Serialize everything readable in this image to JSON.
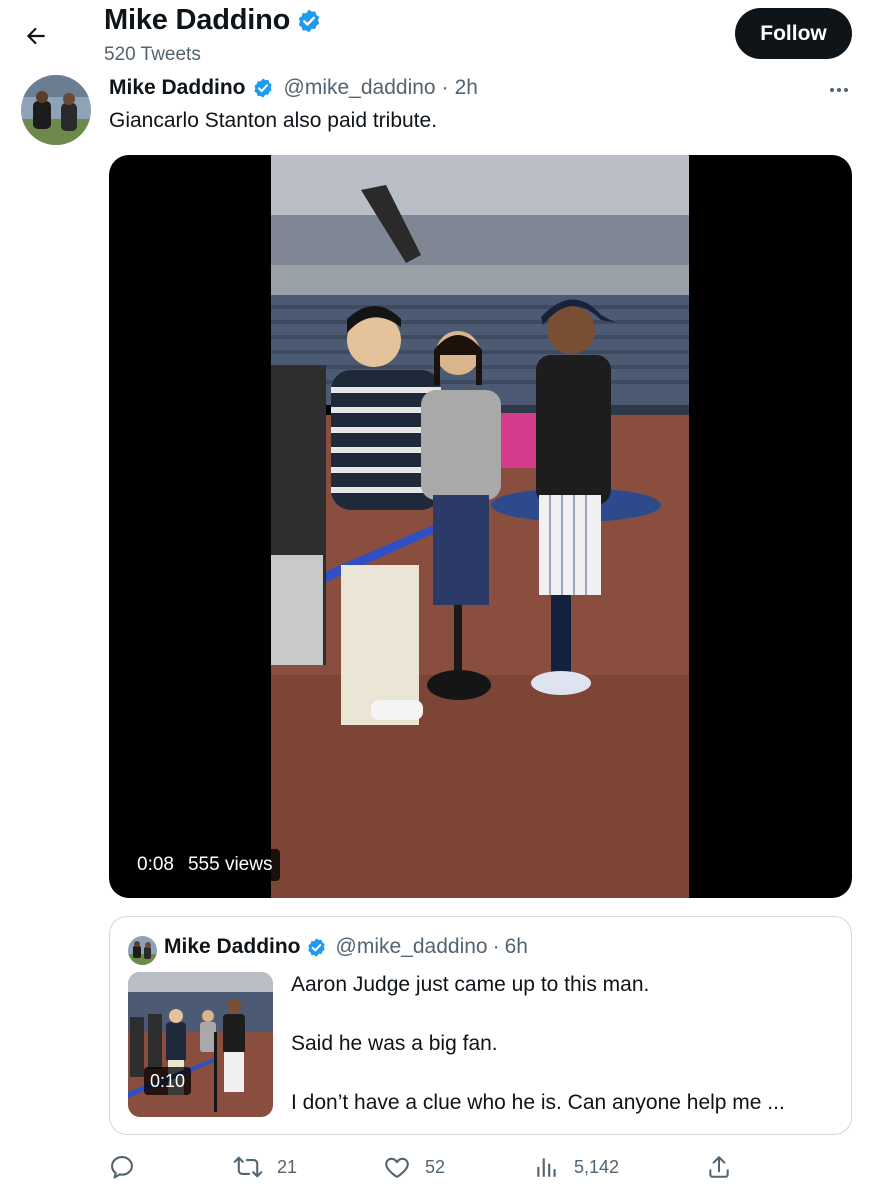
{
  "header": {
    "name": "Mike Daddino",
    "tweets_count": "520 Tweets",
    "follow_label": "Follow"
  },
  "tweet": {
    "name": "Mike Daddino",
    "handle": "@mike_daddino",
    "separator": "·",
    "time": "2h",
    "text": "Giancarlo Stanton also paid tribute.",
    "video": {
      "duration": "0:08",
      "views": "555 views"
    }
  },
  "quote": {
    "name": "Mike Daddino",
    "handle": "@mike_daddino",
    "separator": "·",
    "time": "6h",
    "thumb_duration": "0:10",
    "lines": [
      "Aaron Judge just came up to this man.",
      "Said he was a big fan.",
      "I don’t have a clue who he is. Can anyone help me ..."
    ]
  },
  "actions": {
    "reply": "",
    "retweets": "21",
    "likes": "52",
    "views": "5,142"
  },
  "colors": {
    "text": "#0f1419",
    "secondary": "#536471",
    "verified": "#1d9bf0",
    "border": "#cfd9de",
    "follow_bg": "#0f1419"
  },
  "icons": [
    "back-arrow-icon",
    "verified-badge-icon",
    "more-icon",
    "reply-icon",
    "retweet-icon",
    "like-icon",
    "views-icon",
    "share-icon"
  ]
}
